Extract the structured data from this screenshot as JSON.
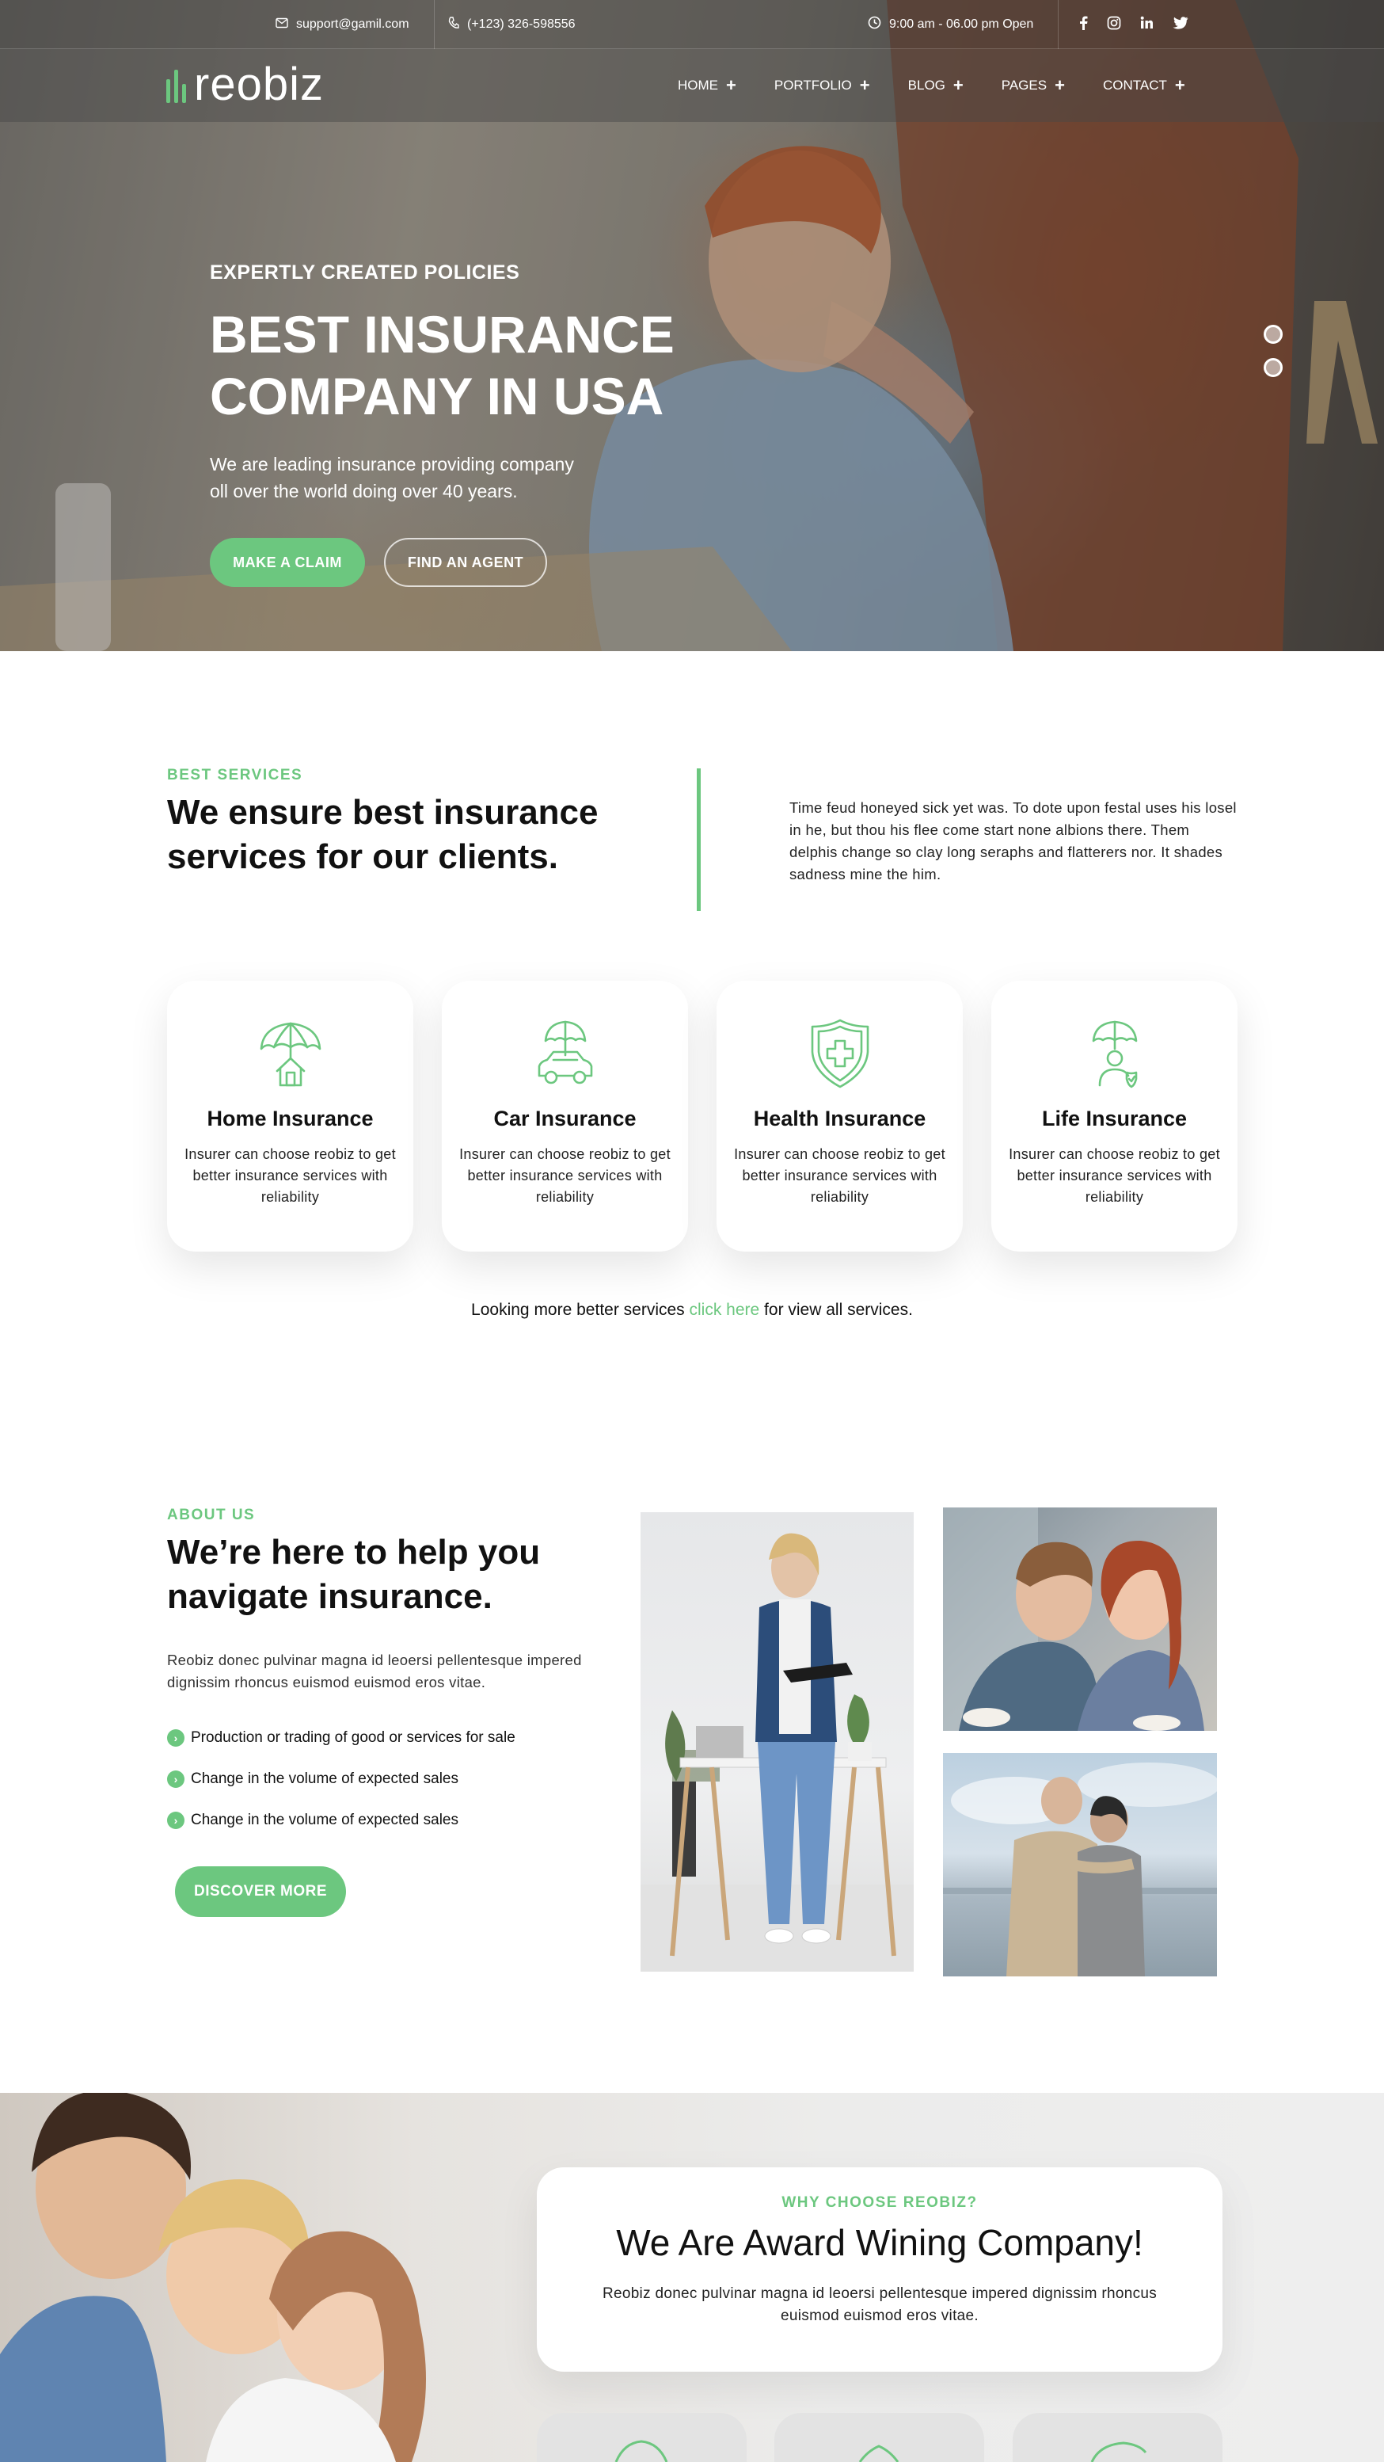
{
  "topbar": {
    "email": "support@gamil.com",
    "phone": "(+123) 326-598556",
    "hours": "9:00 am - 06.00 pm Open",
    "social": [
      "facebook-icon",
      "instagram-icon",
      "linkedin-icon",
      "twitter-icon"
    ]
  },
  "brand": {
    "name": "reobiz",
    "accent": "#6cc77f"
  },
  "nav": {
    "items": [
      {
        "label": "HOME"
      },
      {
        "label": "PORTFOLIO"
      },
      {
        "label": "BLOG"
      },
      {
        "label": "PAGES"
      },
      {
        "label": "CONTACT"
      }
    ],
    "expand_symbol": "+"
  },
  "hero": {
    "eyebrow": "EXPERTLY CREATED POLICIES",
    "title_line1": "BEST INSURANCE",
    "title_line2": "COMPANY IN USA",
    "lead_line1": "We are leading insurance providing company",
    "lead_line2": "oll over the world doing over 40 years.",
    "primary_button": "MAKE A CLAIM",
    "secondary_button": "FIND AN AGENT"
  },
  "services": {
    "eyebrow": "BEST SERVICES",
    "title_line1": "We ensure best insurance",
    "title_line2": "services for our clients.",
    "paragraph": "Time feud honeyed sick yet was. To dote upon festal uses his losel in he, but thou his flee come start none albions there. Them delphis change so clay long seraphs and flatterers nor. It shades sadness mine the him.",
    "cards": [
      {
        "icon": "umbrella-house-icon",
        "title": "Home Insurance",
        "desc": "Insurer can choose reobiz to get better insurance services with reliability"
      },
      {
        "icon": "umbrella-car-icon",
        "title": "Car Insurance",
        "desc": "Insurer can choose reobiz to get better insurance services with reliability"
      },
      {
        "icon": "shield-cross-icon",
        "title": "Health Insurance",
        "desc": "Insurer can choose reobiz to get better insurance services with reliability"
      },
      {
        "icon": "umbrella-person-icon",
        "title": "Life Insurance",
        "desc": "Insurer can choose reobiz to get better insurance services with reliability"
      }
    ],
    "more_prefix": "Looking more better services ",
    "more_link": "click here",
    "more_suffix": " for view all services."
  },
  "about": {
    "eyebrow": "ABOUT US",
    "title_line1": "We’re here to help you",
    "title_line2": "navigate insurance.",
    "paragraph": "Reobiz donec pulvinar magna id leoersi pellentesque impered dignissim rhoncus euismod euismod eros vitae.",
    "checks": [
      "Production or trading of good or services for sale",
      "Change in the volume of expected sales",
      "Change in the volume of expected sales"
    ],
    "button": "DISCOVER MORE"
  },
  "why": {
    "eyebrow": "WHY CHOOSE REOBIZ?",
    "title": "We Are Award Wining Company!",
    "paragraph": "Reobiz donec pulvinar magna id leoersi pellentesque impered dignissim rhoncus euismod euismod eros vitae."
  }
}
